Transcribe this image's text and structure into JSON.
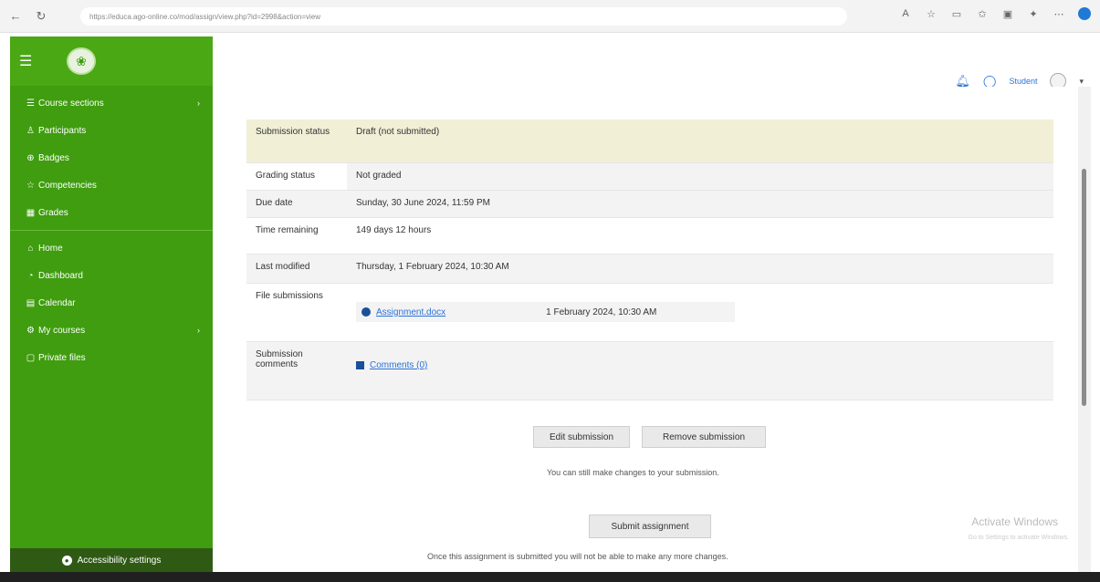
{
  "browser": {
    "url": "https://educa.ago-online.co/mod/assign/view.php?id=2998&action=view",
    "right_icons": [
      "read-aloud-icon",
      "favorite-icon",
      "split-screen-icon",
      "favorites-bar-icon",
      "collections-icon",
      "extensions-icon",
      "more-icon",
      "edge-icon"
    ]
  },
  "sidebar": {
    "items_top": [
      {
        "label": "Course sections",
        "icon": "list-icon",
        "has_chevron": true
      },
      {
        "label": "Participants",
        "icon": "people-icon"
      },
      {
        "label": "Badges",
        "icon": "badge-icon"
      },
      {
        "label": "Competencies",
        "icon": "star-icon"
      },
      {
        "label": "Grades",
        "icon": "grades-icon"
      }
    ],
    "items_bottom": [
      {
        "label": "Home",
        "icon": "home-icon"
      },
      {
        "label": "Dashboard",
        "icon": "dashboard-icon"
      },
      {
        "label": "Calendar",
        "icon": "calendar-icon"
      },
      {
        "label": "My courses",
        "icon": "courses-icon",
        "has_chevron": true
      },
      {
        "label": "Private files",
        "icon": "files-icon"
      }
    ],
    "accessibility": "Accessibility settings"
  },
  "header": {
    "user": "Student"
  },
  "submission": {
    "status_label": "Submission status",
    "status_value": "Draft (not submitted)",
    "grading_label": "Grading status",
    "grading_value": "Not graded",
    "due_label": "Due date",
    "due_value": "Sunday, 30 June 2024, 11:59 PM",
    "remaining_label": "Time remaining",
    "remaining_value": "149 days 12 hours",
    "modified_label": "Last modified",
    "modified_value": "Thursday, 1 February 2024, 10:30 AM",
    "files_label": "File submissions",
    "file_name": "Assignment.docx",
    "file_date": "1 February 2024, 10:30 AM",
    "comments_label": "Submission comments",
    "comments_link": "Comments (0)"
  },
  "actions": {
    "edit": "Edit submission",
    "remove": "Remove submission",
    "edit_note": "You can still make changes to your submission.",
    "submit": "Submit assignment",
    "submit_note": "Once this assignment is submitted you will not be able to make any more changes."
  },
  "watermark": {
    "title": "Activate Windows",
    "subtitle": "Go to Settings to activate Windows."
  }
}
